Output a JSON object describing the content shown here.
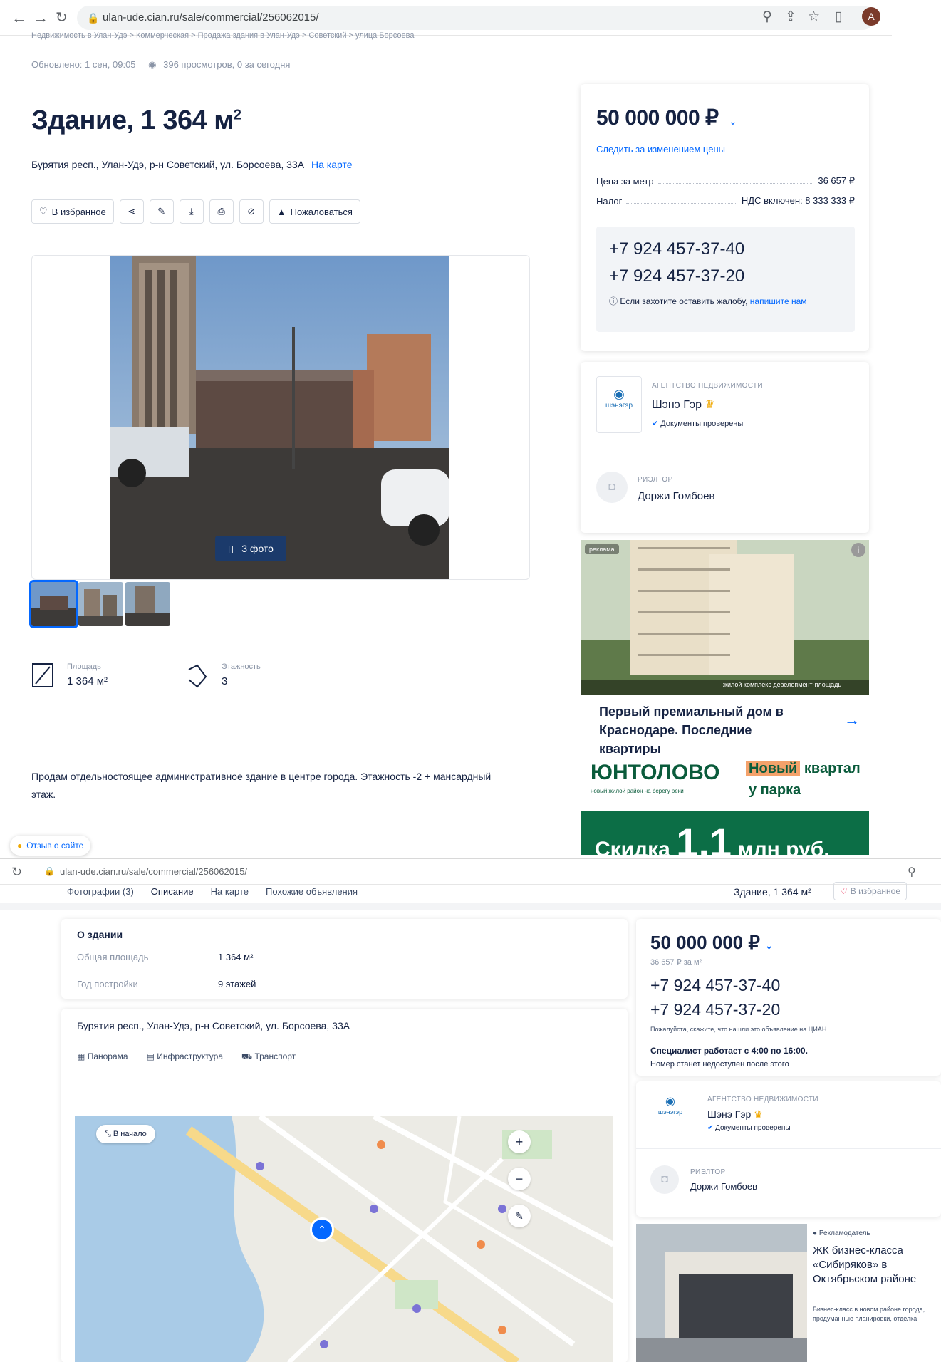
{
  "browser1": {
    "url": "ulan-ude.cian.ru/sale/commercial/256062015/",
    "avatar_letter": "A"
  },
  "breadcrumbs": "Недвижимость в Улан-Удэ  >  Коммерческая  >  Продажа здания в Улан-Удэ  >  Советский  >  улица Борсоева",
  "meta": {
    "updated": "Обновлено: 1 сен, 09:05",
    "views": "396 просмотров, 0 за сегодня"
  },
  "listing": {
    "title": "Здание, 1 364 м",
    "title_sup": "2",
    "address": "Бурятия респ., Улан-Удэ, р-н Советский, ул. Борсоева, 33А",
    "map_link": "На карте",
    "favorite": "В избранное",
    "complain": "Пожаловаться",
    "photo_count": "3 фото",
    "facts": [
      {
        "label": "Площадь",
        "value": "1 364 м²"
      },
      {
        "label": "Этажность",
        "value": "3"
      }
    ],
    "description": "Продам отдельностоящее административное здание в центре города. Этажность -2 + мансардный этаж."
  },
  "feedback": "Отзыв о сайте",
  "price_card": {
    "price": "50 000 000 ₽",
    "follow": "Следить за изменением цены",
    "rows": [
      {
        "label": "Цена за метр",
        "value": "36 657 ₽"
      },
      {
        "label": "Налог",
        "value": "НДС включен: 8 333 333 ₽"
      }
    ],
    "phones": [
      "+7 924 457-37-40",
      "+7 924 457-37-20"
    ],
    "complaint": "Если захотите оставить жалобу,",
    "complaint_link": "напишите нам"
  },
  "agency": {
    "label": "АГЕНТСТВО НЕДВИЖИМОСТИ",
    "name": "Шэнэ Гэр",
    "verified": "Документы проверены",
    "logo_text": "шэнэгэр"
  },
  "realtor": {
    "label": "РИЭЛТОР",
    "name": "Доржи Гомбоев"
  },
  "ads": {
    "ad1_badge": "реклама",
    "ad1_caption": "жилой комплекс девелопмент-площадь",
    "ad1_title": "Первый премиальный дом в Краснодаре. Последние квартиры",
    "ad2_logo": "ЮНТОЛОВО",
    "ad2_sub": "новый жилой район на берегу реки",
    "ad2_slogan_a": "Новый",
    "ad2_slogan_b": "квартал",
    "ad2_slogan_c": "у парка",
    "ad3_text_a": "Скидка",
    "ad3_text_b": "1,1",
    "ad3_text_c": "млн руб."
  },
  "browser2": {
    "url": "ulan-ude.cian.ru/sale/commercial/256062015/"
  },
  "sticky": {
    "tabs": [
      "Фотографии (3)",
      "Описание",
      "На карте",
      "Похожие объявления"
    ],
    "title": "Здание, 1 364 м²",
    "favorite": "В избранное"
  },
  "about": {
    "title": "О здании",
    "rows": [
      {
        "label": "Общая площадь",
        "value": "1 364 м²"
      },
      {
        "label": "Год постройки",
        "value": "9 этажей"
      }
    ]
  },
  "map_section": {
    "address": "Бурятия респ., Улан-Удэ, р-н Советский, ул. Борсоева, 33А",
    "tools": [
      "Панорама",
      "Инфраструктура",
      "Транспорт"
    ],
    "back": "В начало",
    "zoom_in": "+",
    "zoom_out": "−"
  },
  "side2": {
    "price": "50 000 000 ₽",
    "per_m": "36 657 ₽ за м²",
    "phones": [
      "+7 924 457-37-40",
      "+7 924 457-37-20"
    ],
    "note": "Пожалуйста, скажите, что нашли это объявление на ЦИАН",
    "hours": "Специалист работает с 4:00 по 16:00.",
    "hours_note": "Номер станет недоступен после этого",
    "agency_label": "АГЕНТСТВО НЕДВИЖИМОСТИ",
    "agency_name": "Шэнэ Гэр",
    "agency_verified": "Документы проверены",
    "realtor_label": "РИЭЛТОР",
    "realtor_name": "Доржи Гомбоев",
    "ad_badge": "Рекламодатель",
    "ad_title": "ЖК бизнес-класса «Сибиряков» в Октябрьском районе",
    "ad_text": "Бизнес-класс в новом районе города, продуманные планировки, отделка"
  },
  "colors": {
    "accent": "#0468ff",
    "text": "#152242",
    "muted": "#8a94a6"
  }
}
